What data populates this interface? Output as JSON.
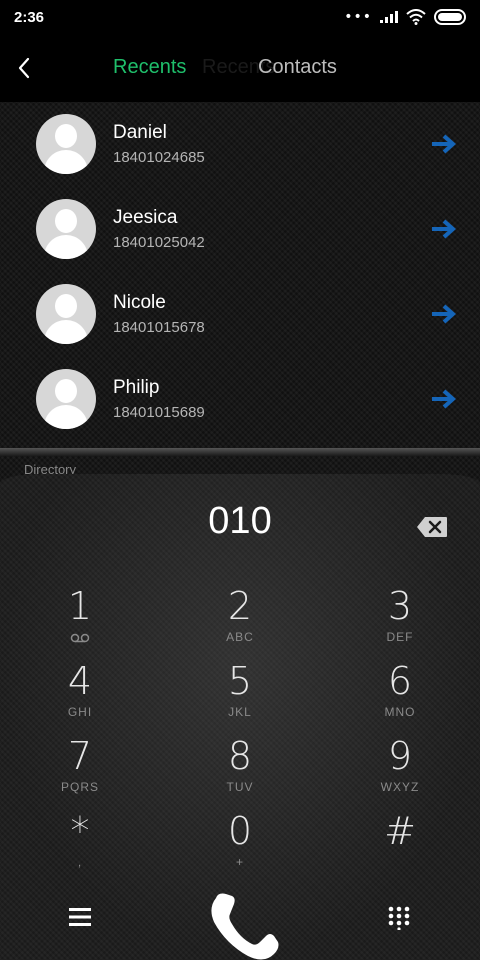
{
  "status_bar": {
    "time": "2:36"
  },
  "header": {
    "tabs": [
      "Recents",
      "Recents",
      "Contacts"
    ]
  },
  "contacts": [
    {
      "name": "Daniel",
      "number": "18401024685"
    },
    {
      "name": "Jeesica",
      "number": "18401025042"
    },
    {
      "name": "Nicole",
      "number": "18401015678"
    },
    {
      "name": "Philip",
      "number": "18401015689"
    }
  ],
  "directory_label": "Directory",
  "dialer": {
    "entry": "010",
    "keys": [
      {
        "digit": "1",
        "letters": ""
      },
      {
        "digit": "2",
        "letters": "ABC"
      },
      {
        "digit": "3",
        "letters": "DEF"
      },
      {
        "digit": "4",
        "letters": "GHI"
      },
      {
        "digit": "5",
        "letters": "JKL"
      },
      {
        "digit": "6",
        "letters": "MNO"
      },
      {
        "digit": "7",
        "letters": "PQRS"
      },
      {
        "digit": "8",
        "letters": "TUV"
      },
      {
        "digit": "9",
        "letters": "WXYZ"
      },
      {
        "digit": "*",
        "letters": ","
      },
      {
        "digit": "0",
        "letters": "+"
      },
      {
        "digit": "#",
        "letters": ""
      }
    ]
  },
  "icons": {
    "back": "chevron-left-icon",
    "arrow": "arrow-right-icon",
    "backspace": "backspace-icon",
    "menu": "menu-icon",
    "call": "phone-icon",
    "keypad": "dialpad-icon",
    "voicemail": "voicemail-icon"
  },
  "colors": {
    "accent": "#1fbf6b",
    "arrow": "#1565b8"
  }
}
